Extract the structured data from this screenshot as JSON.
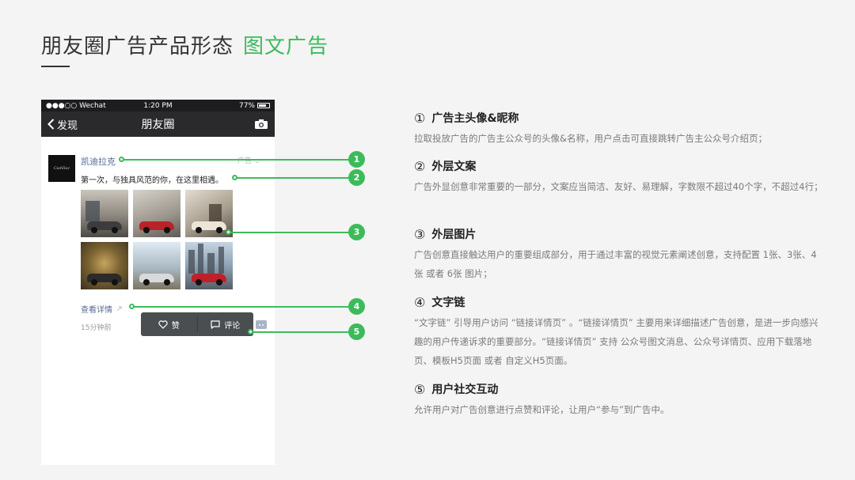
{
  "page": {
    "title_main": "朋友圈广告产品形态",
    "title_highlight": "图文广告",
    "accent_color": "#3dbb5b"
  },
  "phone": {
    "status": {
      "carrier": "●●●○○ Wechat",
      "time": "1:20 PM",
      "battery": "77%"
    },
    "nav": {
      "back_label": "发现",
      "title": "朋友圈",
      "camera_icon": "camera-icon"
    },
    "post": {
      "avatar_text": "Cadillac",
      "name": "凯迪拉克",
      "ad_tag": "广告 ⌄",
      "copy": "第一次，与独具风范的你，在这里相遇。",
      "images": [
        "car-image-1",
        "car-image-2",
        "car-image-3",
        "car-image-4",
        "car-image-5",
        "car-image-6"
      ],
      "more_link": "查看详情",
      "time_ago": "15分钟前",
      "like_label": "赞",
      "comment_label": "评论"
    }
  },
  "callouts": [
    "1",
    "2",
    "3",
    "4",
    "5"
  ],
  "descriptions": [
    {
      "num": "①",
      "title": "广告主头像&昵称",
      "text": "拉取投放广告的广告主公众号的头像&名称，用户点击可直接跳转广告主公众号介绍页；"
    },
    {
      "num": "②",
      "title": "外层文案",
      "text": "广告外显创意非常重要的一部分，文案应当简洁、友好、易理解，字数限不超过40个字，不超过4行；"
    },
    {
      "num": "③",
      "title": "外层图片",
      "text": "广告创意直接触达用户的重要组成部分，用于通过丰富的视觉元素阐述创意，支持配置 1张、3张、4张 或者 6张 图片；"
    },
    {
      "num": "④",
      "title": "文字链",
      "text": "“文字链” 引导用户访问 “链接详情页” 。“链接详情页” 主要用来详细描述广告创意，是进一步向感兴趣的用户传递诉求的重要部分。“链接详情页” 支持 公众号图文消息、公众号详情页、应用下载落地页、模板H5页面 或者 自定义H5页面。"
    },
    {
      "num": "⑤",
      "title": "用户社交互动",
      "text": "允许用户对广告创意进行点赞和评论，让用户“参与”到广告中。"
    }
  ]
}
